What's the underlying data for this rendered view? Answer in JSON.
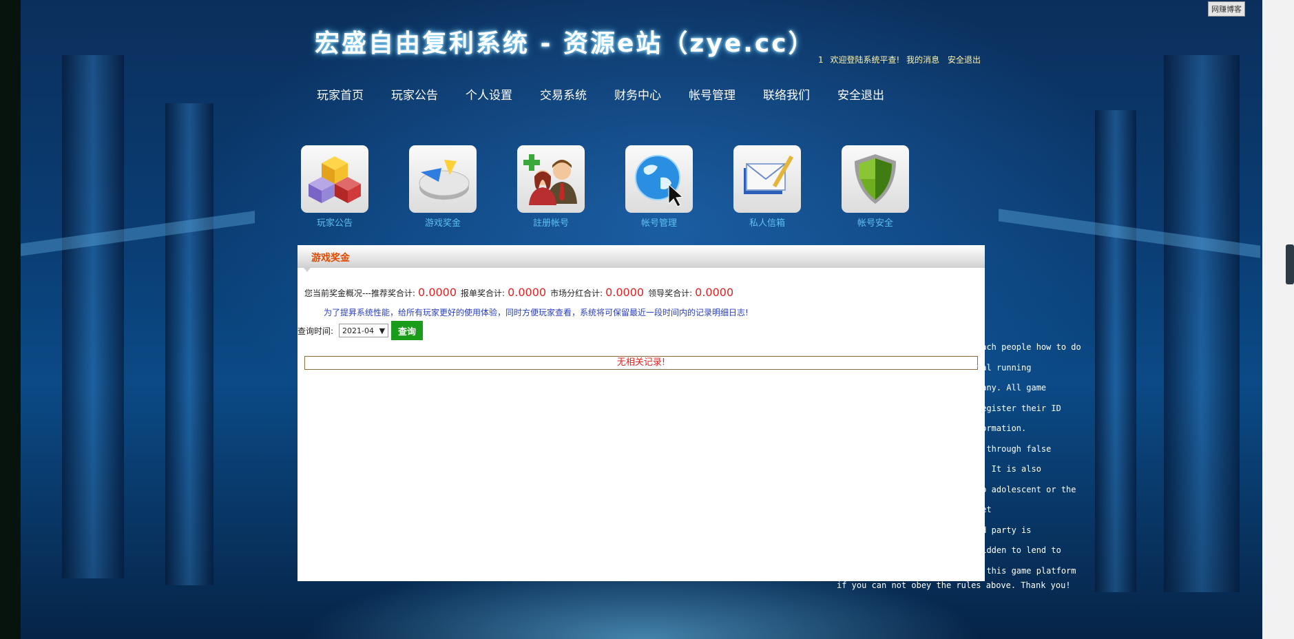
{
  "widget": {
    "label": "网赚博客"
  },
  "header": {
    "site_title": "宏盛自由复利系统 - 资源e站（zye.cc）",
    "user_id": "1",
    "welcome": "欢迎登陆系统平查!",
    "my_messages": "我的消息",
    "logout": "安全退出"
  },
  "nav": {
    "items": [
      {
        "label": "玩家首页"
      },
      {
        "label": "玩家公告"
      },
      {
        "label": "个人设置"
      },
      {
        "label": "交易系统"
      },
      {
        "label": "财务中心"
      },
      {
        "label": "帐号管理"
      },
      {
        "label": "联络我们"
      },
      {
        "label": "安全退出"
      }
    ]
  },
  "quick_icons": [
    {
      "label": "玩家公告",
      "icon": "cubes-icon"
    },
    {
      "label": "游戏奖金",
      "icon": "pie-chart-icon"
    },
    {
      "label": "註册帐号",
      "icon": "add-user-icon"
    },
    {
      "label": "帐号管理",
      "icon": "globe-icon"
    },
    {
      "label": "私人信箱",
      "icon": "mail-icon"
    },
    {
      "label": "帐号安全",
      "icon": "shield-icon"
    }
  ],
  "panel": {
    "title": "游戏奖金",
    "summary_prefix": "您当前奖金概况---推荐奖合计:",
    "recommend_total": "0.0000",
    "report_label": "报单奖合计:",
    "report_total": "0.0000",
    "market_label": "市场分红合计:",
    "market_total": "0.0000",
    "leader_label": "领导奖合计:",
    "leader_total": "0.0000",
    "notice": "为了提昇系统性能，给所有玩家更好的使用体验，同时方便玩家查看，系统将可保留最近一段时间内的记录明细日志!",
    "query_label": "查询时间:",
    "query_value": "2021-04",
    "query_button": "查询",
    "no_record": "无相关记录!"
  },
  "rules_text": [
    "each people how to do",
    "tal running",
    "pany. All game",
    "register their ID",
    "formation.",
    "e through false",
    "l. It is also",
    "to adolescent or the",
    "net",
    "rd party is",
    "bidden to lend to",
    "n this game platform"
  ],
  "rules_last": "if you can not obey the rules above. Thank you!"
}
